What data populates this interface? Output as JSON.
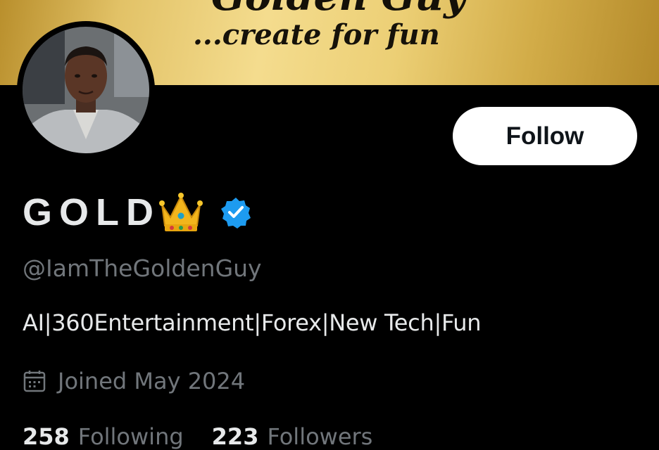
{
  "banner": {
    "top_text": "Golden Guy",
    "tagline": "...create for fun"
  },
  "profile": {
    "display_name": "GOLD",
    "handle": "@IamTheGoldenGuy",
    "bio": "AI|360Entertainment|Forex|New Tech|Fun",
    "joined": "Joined May 2024",
    "verified": true
  },
  "actions": {
    "follow_label": "Follow"
  },
  "stats": {
    "following_count": "258",
    "following_label": "Following",
    "followers_count": "223",
    "followers_label": "Followers"
  },
  "icons": {
    "crown": "crown-emoji-icon",
    "verified": "verified-badge-icon",
    "calendar": "calendar-icon"
  },
  "colors": {
    "background": "#000000",
    "primary_text": "#e7e9ea",
    "secondary_text": "#71767b",
    "verified_blue": "#1d9bf0",
    "gold": "#e2c267"
  }
}
